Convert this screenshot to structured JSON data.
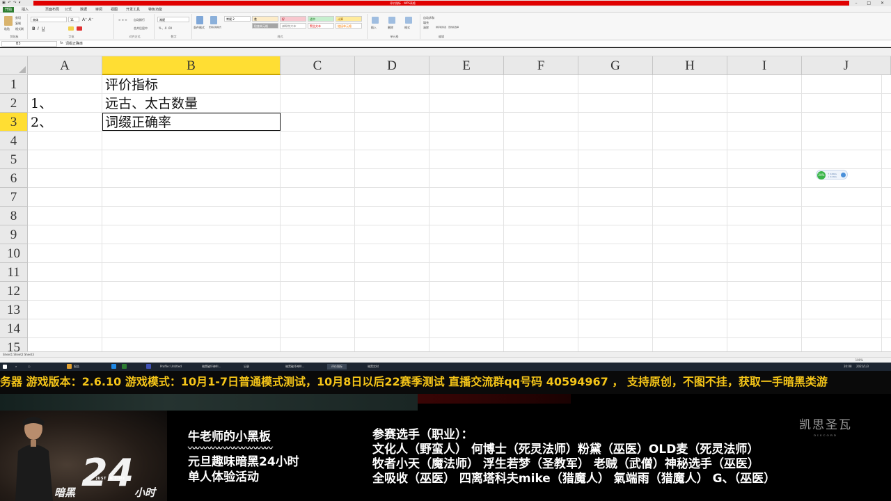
{
  "window": {
    "title": "评价指标 - WPS表格",
    "controls": "–  □  ✕",
    "quick_access": "▣ ↶ ↷ ▾"
  },
  "menu": {
    "tabs": [
      "开始",
      "插入",
      "页面布局",
      "公式",
      "数据",
      "审阅",
      "视图",
      "开发工具",
      "特色功能"
    ]
  },
  "ribbon": {
    "clipboard": {
      "label": "剪贴板",
      "paste": "粘贴",
      "cut": "剪切",
      "copy": "复制",
      "brush": "格式刷"
    },
    "font": {
      "label": "字体",
      "name": "宋体",
      "size": "11"
    },
    "align": {
      "label": "对齐方式",
      "wrap": "自动换行",
      "merge": "合并后居中"
    },
    "number": {
      "label": "数字",
      "format": "常规"
    },
    "styles": {
      "label": "样式",
      "cond": "条件格式",
      "table": "套用表格格式",
      "normal": "常规 2",
      "bad": "差",
      "good": "好",
      "neutral": "适中",
      "calc": "计算",
      "check": "检查单元格",
      "explain": "解释性文本",
      "warn": "警告文本",
      "link": "链接单元格",
      "note": "注释"
    },
    "cells": {
      "label": "单元格",
      "insert": "插入",
      "delete": "删除",
      "format": "格式"
    },
    "edit": {
      "label": "编辑",
      "sum": "自动求和",
      "fill": "填充",
      "clear": "清除",
      "sort": "排序和筛选",
      "find": "查找和选择"
    }
  },
  "formula_bar": {
    "name_box": "B3",
    "fx": "fx",
    "content": "词缀正确率"
  },
  "sheet": {
    "columns": [
      "A",
      "B",
      "C",
      "D",
      "E",
      "F",
      "G",
      "H",
      "I",
      "J"
    ],
    "selected_column": "B",
    "rows": [
      "1",
      "2",
      "3",
      "4",
      "5",
      "6",
      "7",
      "8",
      "9",
      "10",
      "11",
      "12",
      "13",
      "14",
      "15"
    ],
    "selected_row": "3",
    "cells": {
      "A2": "1、",
      "A3": "2、",
      "B1": "评价指标",
      "B2": "远古、太古数量",
      "B3": "词缀正确率"
    },
    "tabs": "Sheet1  Sheet2  Sheet3",
    "float_widget": {
      "percent": "20%",
      "line1": "↑ 0.6K/s",
      "line2": "↓ 0.1K/s"
    }
  },
  "status": {
    "zoom": "100%"
  },
  "taskbar": {
    "items": [
      "报告",
      "Profile: Untitled",
      "暗黑破坏神III…",
      "记录",
      "暗黑破坏神III…",
      "评价指标",
      "暗黑实时"
    ],
    "time": "20:08",
    "date": "2021/1/3"
  },
  "ticker": {
    "text": "务器  游戏版本：2.6.10    游戏模式：10月1-7日普通模式测试，10月8日以后22赛季测试    直播交流群qq号码 40594967 ， 支持原创，不图不挂，获取一手暗黑类游"
  },
  "overlay": {
    "logo": {
      "left": "暗黑",
      "number": "24",
      "just": "JUST IN TIME",
      "right": "小时"
    },
    "board_title": "牛老师的小黑板",
    "board_squiggle": "〰〰〰〰〰〰〰〰〰〰〰",
    "board_line1": "元旦趣味暗黑24小时",
    "board_line2": "单人体验活动",
    "players_title": "参赛选手（职业）：",
    "players": [
      "文化人（野蛮人） 何博士（死灵法师）粉黛（巫医）OLD麦（死灵法师）",
      "牧者小天（魔法师） 浮生若梦（圣教军） 老贼（武僧）神秘选手（巫医）",
      "全吸收（巫医）  四离塔科夫mike（猎魔人） 氣端雨（猎魔人） G、（巫医）"
    ],
    "brand": "凯思圣瓦",
    "brand_sub": "DISCORD"
  },
  "colors": {
    "selection": "#ffde33",
    "excel_green": "#2e7d32",
    "ticker_yellow": "#f5c518",
    "titlebar_red": "#e00000"
  }
}
